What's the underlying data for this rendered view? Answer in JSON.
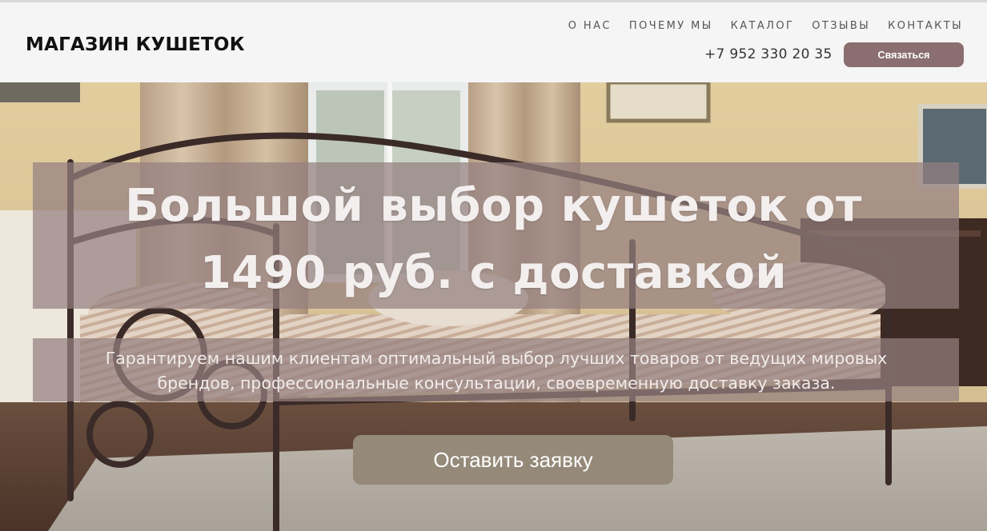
{
  "header": {
    "logo": "МАГАЗИН КУШЕТОК",
    "nav": [
      {
        "label": "О НАС"
      },
      {
        "label": "ПОЧЕМУ МЫ"
      },
      {
        "label": "КАТАЛОГ"
      },
      {
        "label": "ОТЗЫВЫ"
      },
      {
        "label": "КОНТАКТЫ"
      }
    ],
    "phone": "+7 952 330 20 35",
    "contact_button": "Связаться"
  },
  "hero": {
    "headline_line1": "Большой выбор кушеток от",
    "headline_line2": "1490 руб. с доставкой",
    "subtext_line1": "Гарантируем нашим клиентам оптимальный выбор лучших товаров от ведущих мировых",
    "subtext_line2": "брендов, профессиональные консультации, своевременную доставку заказа.",
    "cta_button": "Оставить заявку"
  },
  "colors": {
    "accent": "#8b6f70",
    "cta": "#958a79",
    "overlay": "#948080"
  }
}
